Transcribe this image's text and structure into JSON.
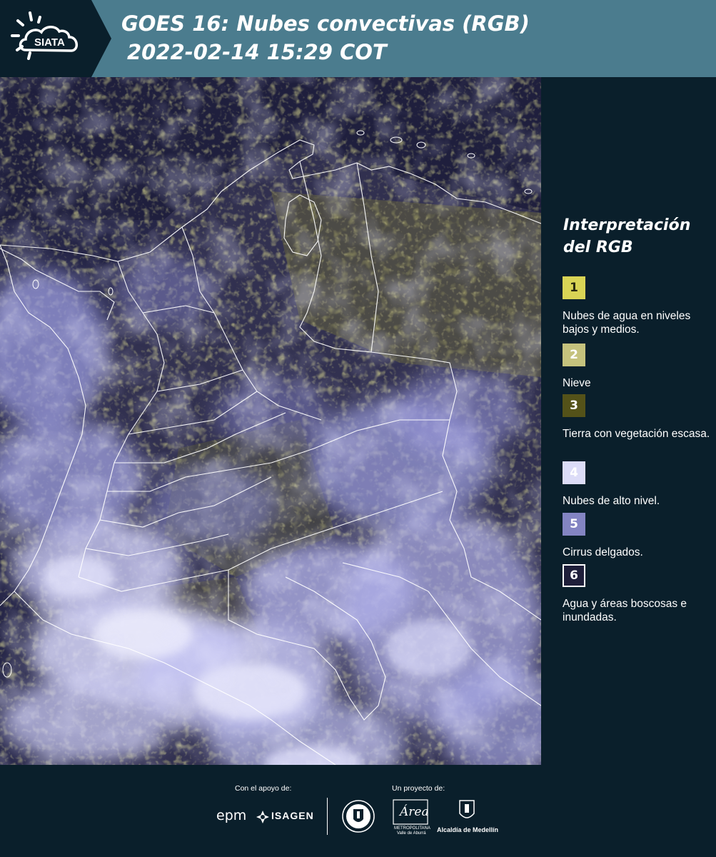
{
  "header": {
    "brand": "SIATA",
    "title_line1": "GOES 16: Nubes convectivas (RGB)",
    "title_line2": "2022-02-14 15:29 COT"
  },
  "legend": {
    "title": "Interpretación del RGB",
    "items": [
      {
        "number": "1",
        "color": "#d9d455",
        "text_color": "#2a2a10",
        "description": "Nubes de agua en niveles bajos y medios."
      },
      {
        "number": "2",
        "color": "#c5c27d",
        "text_color": "#ffffff",
        "description": "Nieve"
      },
      {
        "number": "3",
        "color": "#545219",
        "text_color": "#ffffff",
        "description": "Tierra con vegetación escasa."
      },
      {
        "number": "4",
        "color": "#dcdcf7",
        "text_color": "#ffffff",
        "description": "Nubes de alto nivel."
      },
      {
        "number": "5",
        "color": "#8384c2",
        "text_color": "#ffffff",
        "description": "Cirrus delgados."
      },
      {
        "number": "6",
        "color": "#1f1f3a",
        "text_color": "#ffffff",
        "description": "Agua y áreas boscosas e inundadas."
      }
    ]
  },
  "footer": {
    "support_label": "Con el apoyo de:",
    "project_label": "Un proyecto de:",
    "sponsors": [
      "epm",
      "ISAGEN"
    ],
    "area_label": "Área",
    "area_sub1": "METROPOLITANA",
    "area_sub2": "Valle de Aburrá",
    "alcaldia_label": "Alcaldía de Medellín"
  }
}
